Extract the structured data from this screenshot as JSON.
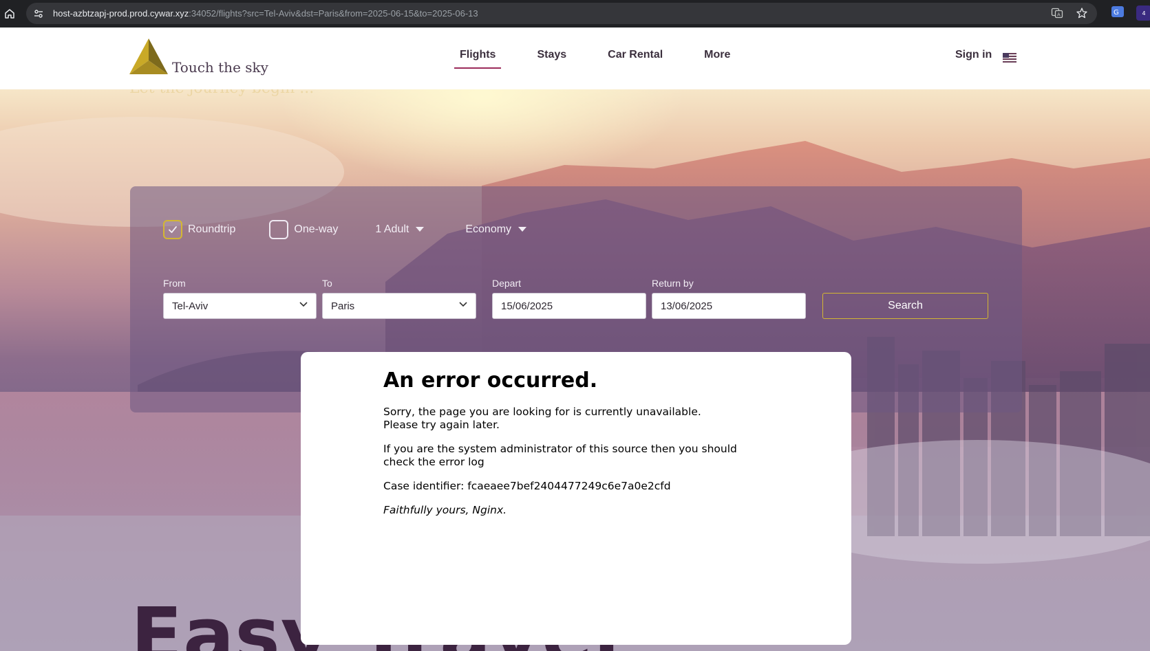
{
  "browser": {
    "url_host": "host-azbtzapj-prod.prod.cywar.xyz",
    "url_rest": ":34052/flights?src=Tel-Aviv&dst=Paris&from=2025-06-15&to=2025-06-13",
    "extension_badge": "4"
  },
  "header": {
    "logo_text": "Touch the sky",
    "nav": [
      "Flights",
      "Stays",
      "Car Rental",
      "More"
    ],
    "active_nav": "Flights",
    "signin_label": "Sign in",
    "locale_icon": "us-flag-icon"
  },
  "hero": {
    "tagline": "Let the journey begin ...",
    "headline": "Easy Travel"
  },
  "search": {
    "trip_types": [
      {
        "label": "Roundtrip",
        "checked": true
      },
      {
        "label": "One-way",
        "checked": false
      }
    ],
    "passengers": "1 Adult",
    "cabin": "Economy",
    "from_label": "From",
    "from_value": "Tel-Aviv",
    "to_label": "To",
    "to_value": "Paris",
    "depart_label": "Depart",
    "depart_value": "15/06/2025",
    "return_label": "Return by",
    "return_value": "13/06/2025",
    "search_button": "Search"
  },
  "error": {
    "title": "An error occurred.",
    "line1": "Sorry, the page you are looking for is currently unavailable.",
    "line2": "Please try again later.",
    "admin_note": "If you are the system administrator of this source then you should check the error log",
    "case_id": "Case identifier: fcaeaee7bef2404477249c6e7a0e2cfd",
    "signature": "Faithfully yours, Nginx."
  },
  "colors": {
    "accent_gold": "#d4b732",
    "nav_underline": "#9b2b5a",
    "chrome_bg": "#202124",
    "urlbar_bg": "#35363a"
  }
}
